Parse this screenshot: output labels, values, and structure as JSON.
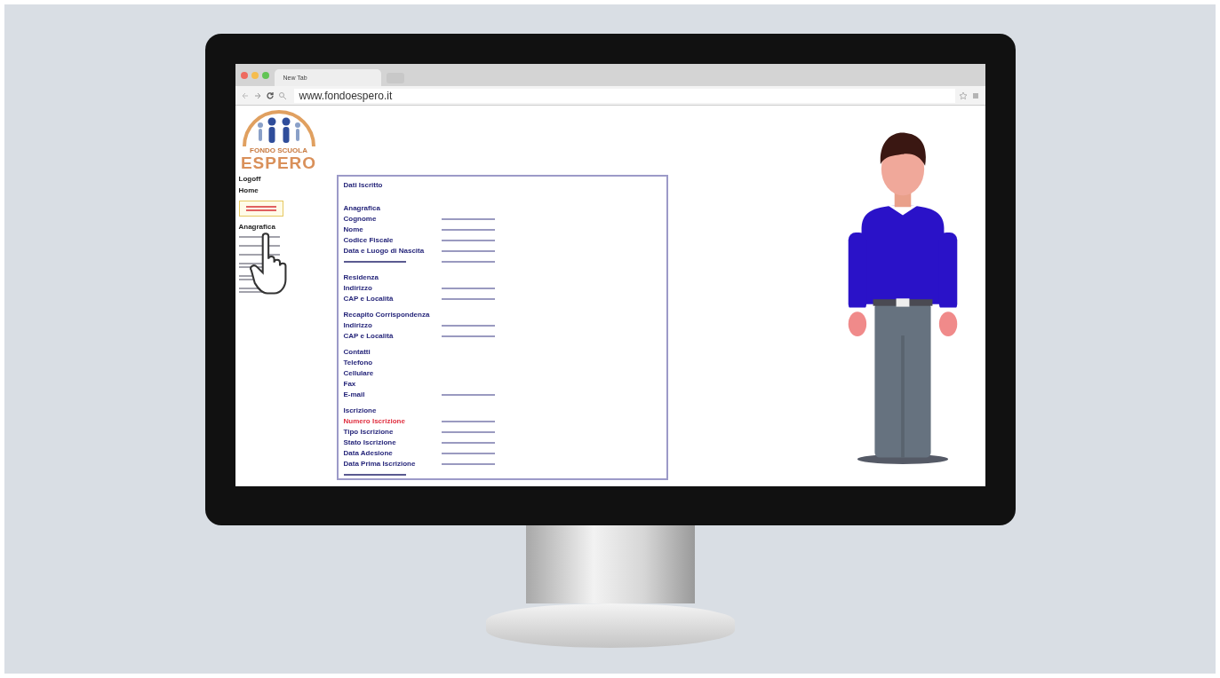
{
  "browser": {
    "tab_title": "New Tab",
    "url": "www.fondoespero.it"
  },
  "logo": {
    "tagline": "FONDO SCUOLA",
    "name": "ESPERO"
  },
  "sidebar": {
    "items": [
      {
        "kind": "link",
        "label": "Logoff"
      },
      {
        "kind": "link",
        "label": "Home"
      },
      {
        "kind": "button"
      },
      {
        "kind": "link",
        "label": "Anagrafica"
      },
      {
        "kind": "link",
        "wrapped": false
      },
      {
        "kind": "link",
        "wrapped": false
      },
      {
        "kind": "link",
        "wrapped": false
      },
      {
        "kind": "link",
        "wrapped": true
      },
      {
        "kind": "link",
        "wrapped": true
      },
      {
        "kind": "link",
        "wrapped": true
      }
    ]
  },
  "record": {
    "title": "Dati Iscritto",
    "sections": [
      {
        "title": "Anagrafica",
        "rows": [
          {
            "label": "Cognome",
            "kind": "filled"
          },
          {
            "label": "Nome",
            "kind": "filled"
          },
          {
            "label": "Codice Fiscale",
            "kind": "filled"
          },
          {
            "label": "Data e Luogo di Nascita",
            "kind": "filled"
          },
          {
            "kind": "filled"
          }
        ]
      },
      {
        "title": "Residenza",
        "rows": [
          {
            "label": "Indirizzo",
            "kind": "filled"
          },
          {
            "label": "CAP e Località",
            "kind": "filled"
          }
        ]
      },
      {
        "title": "Recapito Corrispondenza",
        "rows": [
          {
            "label": "Indirizzo",
            "kind": "filled"
          },
          {
            "label": "CAP e Località",
            "kind": "filled"
          }
        ]
      },
      {
        "title": "Contatti",
        "rows": [
          {
            "label": "Telefono",
            "kind": "blank"
          },
          {
            "label": "Cellulare",
            "kind": "blank"
          },
          {
            "label": "Fax",
            "kind": "blank"
          },
          {
            "label": "E-mail",
            "kind": "filled"
          }
        ]
      },
      {
        "title": "Iscrizione",
        "rows": [
          {
            "label": "Numero Iscrizione",
            "kind": "filled",
            "color": "#e03040"
          },
          {
            "label": "Tipo Iscrizione",
            "kind": "filled"
          },
          {
            "label": "Stato Iscrizione",
            "kind": "filled"
          },
          {
            "label": "Data Adesione",
            "kind": "filled"
          },
          {
            "label": "Data Prima Iscrizione",
            "kind": "filled"
          },
          {
            "kind": "blank"
          }
        ]
      }
    ]
  }
}
